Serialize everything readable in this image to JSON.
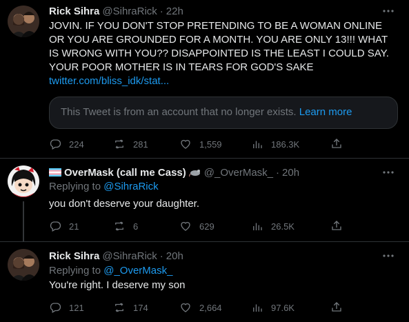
{
  "tweets": [
    {
      "name": "Rick Sihra",
      "handle": "@SihraRick",
      "time": "22h",
      "text": "JOVIN. IF YOU DON'T STOP PRETENDING TO BE A WOMAN ONLINE OR YOU ARE GROUNDED FOR A MONTH. YOU ARE ONLY 13!!! WHAT IS WRONG WITH YOU?? DISAPPOINTED IS THE LEAST I COULD SAY. YOUR POOR MOTHER IS IN TEARS FOR GOD'S SAKE",
      "link": "twitter.com/bliss_idk/stat...",
      "quote_text": "This Tweet is from an account that no longer exists.",
      "quote_link": "Learn more",
      "replies": "224",
      "retweets": "281",
      "likes": "1,559",
      "views": "186.3K"
    },
    {
      "name": "OverMask (call me Cass)",
      "handle": "@_OverMask_",
      "time": "20h",
      "replying_label": "Replying to",
      "replying_to": "@SihraRick",
      "text": "you don't deserve your daughter.",
      "replies": "21",
      "retweets": "6",
      "likes": "629",
      "views": "26.5K"
    },
    {
      "name": "Rick Sihra",
      "handle": "@SihraRick",
      "time": "20h",
      "replying_label": "Replying to",
      "replying_to": "@_OverMask_",
      "text": "You're right. I deserve my son",
      "replies": "121",
      "retweets": "174",
      "likes": "2,664",
      "views": "97.6K"
    }
  ],
  "colors": {
    "background": "#000000",
    "text": "#e7e9ea",
    "muted": "#71767b",
    "link": "#1d9bf0",
    "border": "#2f3336"
  },
  "icons": {
    "reply": "reply-icon",
    "retweet": "retweet-icon",
    "like": "heart-icon",
    "views": "views-icon",
    "share": "share-icon",
    "more": "more-icon"
  }
}
